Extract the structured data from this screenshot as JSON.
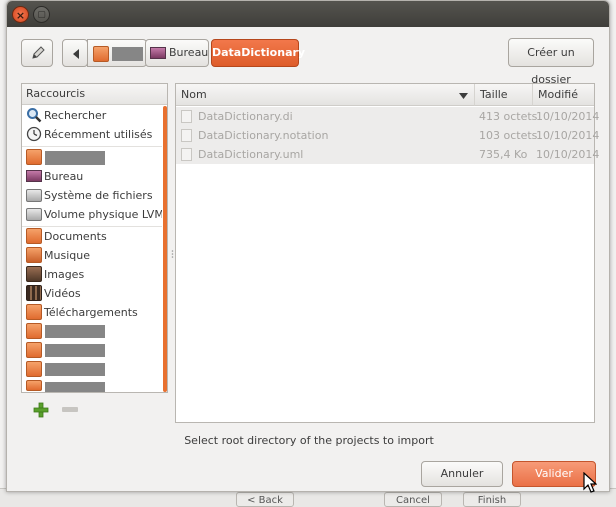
{
  "toolbar": {
    "path": {
      "second": "Bureau",
      "current": "DataDictionary"
    },
    "create_folder": "Créer un dossier"
  },
  "sidebar": {
    "header": "Raccourcis",
    "group1": [
      {
        "label": "Rechercher",
        "icon": "search-icon"
      },
      {
        "label": "Récemment utilisés",
        "icon": "recent-icon"
      }
    ],
    "group2": [
      {
        "label": "",
        "icon": "home-folder-icon",
        "redacted": true
      },
      {
        "label": "Bureau",
        "icon": "desktop-icon"
      },
      {
        "label": "Système de fichiers",
        "icon": "drive-icon"
      },
      {
        "label": "Volume physique LVM…",
        "icon": "drive-icon"
      }
    ],
    "group3": [
      {
        "label": "Documents",
        "icon": "documents-folder-icon"
      },
      {
        "label": "Musique",
        "icon": "music-folder-icon"
      },
      {
        "label": "Images",
        "icon": "pictures-folder-icon"
      },
      {
        "label": "Vidéos",
        "icon": "videos-folder-icon"
      },
      {
        "label": "Téléchargements",
        "icon": "downloads-folder-icon"
      },
      {
        "label": "",
        "icon": "folder-icon",
        "redacted": true
      },
      {
        "label": "",
        "icon": "folder-icon",
        "redacted": true
      },
      {
        "label": "",
        "icon": "folder-icon",
        "redacted": true
      },
      {
        "label": "",
        "icon": "folder-icon",
        "redacted": true
      }
    ]
  },
  "filelist": {
    "columns": {
      "name": "Nom",
      "size": "Taille",
      "modified": "Modifié"
    },
    "rows": [
      {
        "name": "DataDictionary.di",
        "size": "413 octets",
        "modified": "10/10/2014"
      },
      {
        "name": "DataDictionary.notation",
        "size": "103 octets",
        "modified": "10/10/2014"
      },
      {
        "name": "DataDictionary.uml",
        "size": "735,4 Ko",
        "modified": "10/10/2014"
      }
    ]
  },
  "footer": {
    "hint": "Select root directory of the projects to import",
    "cancel": "Annuler",
    "ok": "Valider"
  },
  "background_window": {
    "buttons": [
      "< Back",
      "Cancel",
      "Finish"
    ]
  },
  "colors": {
    "accent": "#e8702f",
    "titlebar": "#4a4945",
    "ok_button": "#f08a60"
  }
}
